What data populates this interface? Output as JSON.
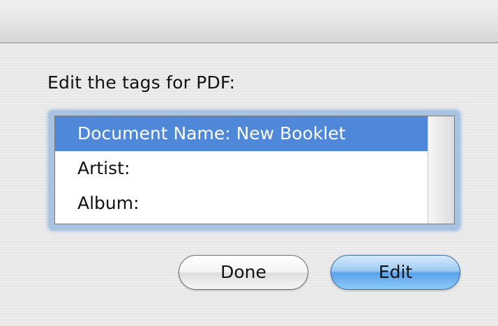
{
  "dialog": {
    "prompt": "Edit the tags for PDF:"
  },
  "tags_list": {
    "items": [
      {
        "label": "Document Name: New Booklet",
        "selected": true
      },
      {
        "label": "Artist:",
        "selected": false
      },
      {
        "label": "Album:",
        "selected": false
      }
    ]
  },
  "buttons": {
    "done_label": "Done",
    "edit_label": "Edit"
  },
  "colors": {
    "selection": "#4f88d8",
    "default_button": "#5aa2ea",
    "window_background": "#ececec"
  }
}
